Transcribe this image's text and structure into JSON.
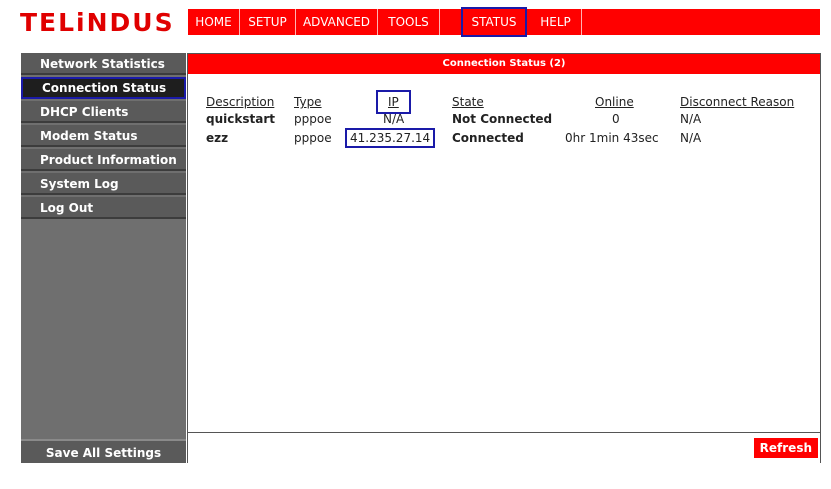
{
  "logo": {
    "text": "TELiNDUS"
  },
  "topnav": {
    "items": [
      {
        "label": "HOME"
      },
      {
        "label": "SETUP"
      },
      {
        "label": "ADVANCED"
      },
      {
        "label": "TOOLS"
      },
      {
        "label": "STATUS"
      },
      {
        "label": "HELP"
      }
    ],
    "active": "STATUS"
  },
  "sidebar": {
    "items": [
      {
        "label": "Network Statistics"
      },
      {
        "label": "Connection Status"
      },
      {
        "label": "DHCP Clients"
      },
      {
        "label": "Modem Status"
      },
      {
        "label": "Product Information"
      },
      {
        "label": "System Log"
      },
      {
        "label": "Log Out"
      }
    ],
    "active": "Connection Status",
    "save_label": "Save All Settings"
  },
  "panel": {
    "title": "Connection Status (2)",
    "columns": [
      "Description",
      "Type",
      "IP",
      "State",
      "Online",
      "Disconnect Reason"
    ],
    "rows": [
      {
        "description": "quickstart",
        "type": "pppoe",
        "ip": "N/A",
        "state": "Not Connected",
        "online": "0",
        "reason": "N/A"
      },
      {
        "description": "ezz",
        "type": "pppoe",
        "ip": "41.235.27.14",
        "state": "Connected",
        "online": "0hr 1min 43sec",
        "reason": "N/A"
      }
    ],
    "refresh_label": "Refresh"
  },
  "colors": {
    "brand_red": "#ff0000",
    "sidebar_gray": "#5a5a5a",
    "highlight_blue": "#1a1aa8"
  }
}
